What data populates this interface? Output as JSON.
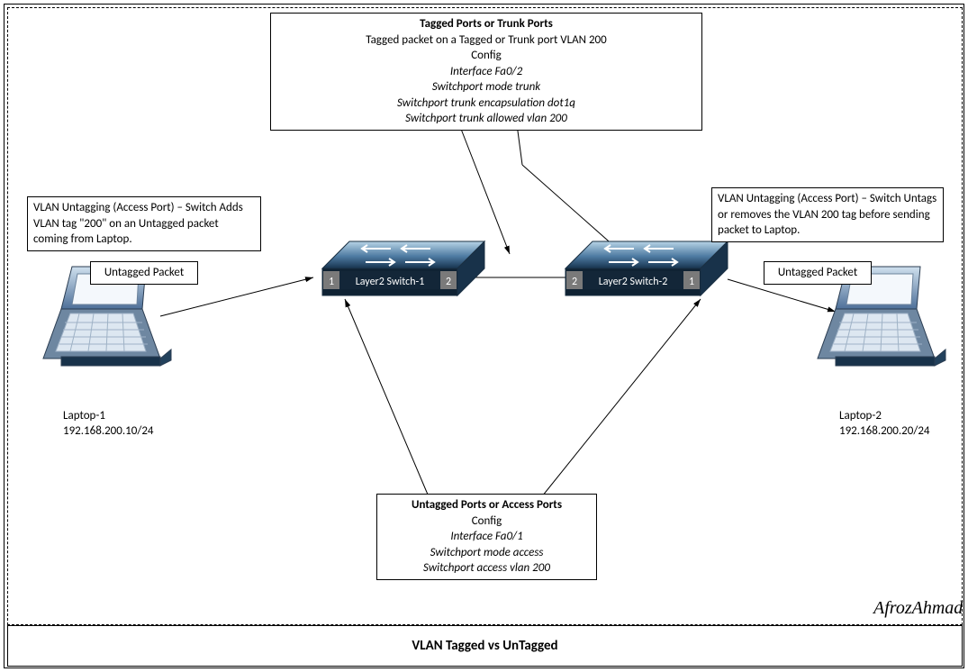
{
  "title": "VLAN Tagged vs UnTagged",
  "signature": "AfrozAhmad",
  "tagged_box": {
    "header": "Tagged Ports or Trunk Ports",
    "line1": "Tagged packet on a Tagged or Trunk port  VLAN 200",
    "line2": "Config",
    "cfg1": "Interface Fa0/2",
    "cfg2": "Switchport mode trunk",
    "cfg3": "Switchport trunk encapsulation dot1q",
    "cfg4": "Switchport trunk allowed vlan 200"
  },
  "untagged_box": {
    "header": "Untagged Ports or Access Ports",
    "line2": "Config",
    "cfg1": "Interface Fa0/1",
    "cfg2": "Switchport mode access",
    "cfg3": "Switchport access vlan 200"
  },
  "left_note": {
    "text": "VLAN Untagging (Access Port) – Switch Adds VLAN tag \"200\" on an Untagged packet coming from Laptop."
  },
  "right_note": {
    "text": "VLAN Untagging (Access Port) – Switch Untags or removes the VLAN 200 tag before sending packet to Laptop."
  },
  "packet_left": "Untagged Packet",
  "packet_right": "Untagged Packet",
  "switch1": {
    "name": "Layer2 Switch-1",
    "port_left": "1",
    "port_right": "2"
  },
  "switch2": {
    "name": "Layer2 Switch-2",
    "port_left": "2",
    "port_right": "1"
  },
  "laptop1": {
    "name": "Laptop-1",
    "ip": "192.168.200.10/24"
  },
  "laptop2": {
    "name": "Laptop-2",
    "ip": "192.168.200.20/24"
  }
}
